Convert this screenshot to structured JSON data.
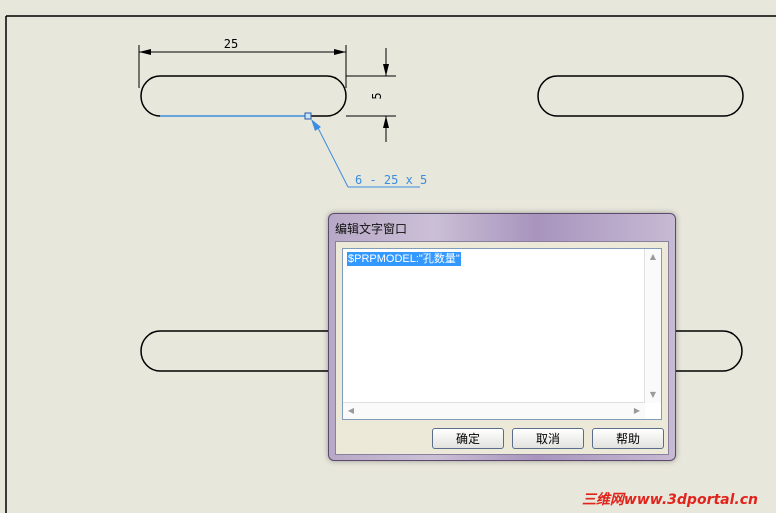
{
  "drawing": {
    "dim_width": "25",
    "dim_height": "5",
    "note": "6 - 25 x 5"
  },
  "dialog": {
    "title": "编辑文字窗口",
    "text": "$PRPMODEL:\"孔数量\"",
    "ok_label": "确定",
    "cancel_label": "取消",
    "help_label": "帮助"
  },
  "watermark": "三维网www.3dportal.cn",
  "colors": {
    "background": "#e8e7dc",
    "accent_blue": "#3a8de0",
    "selection": "#3399ff",
    "watermark": "#e0241c"
  }
}
